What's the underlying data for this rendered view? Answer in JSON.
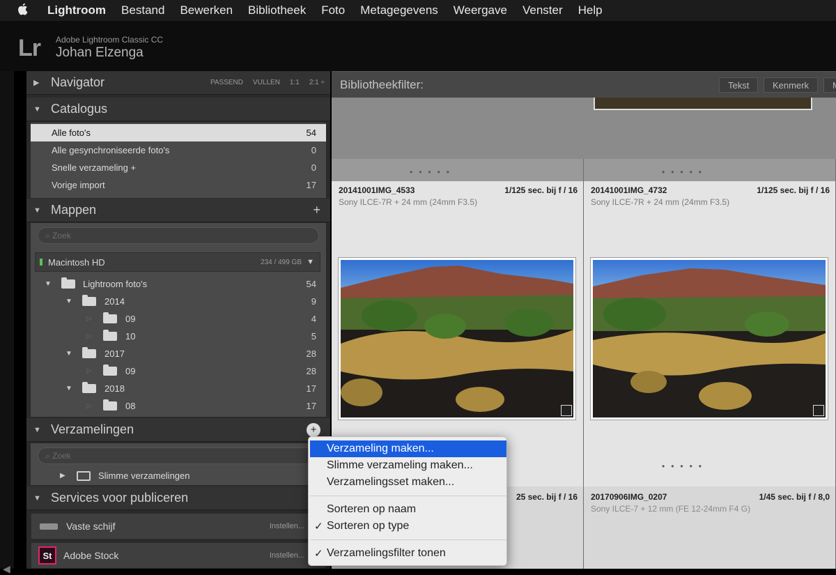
{
  "menubar": {
    "app": "Lightroom",
    "items": [
      "Bestand",
      "Bewerken",
      "Bibliotheek",
      "Foto",
      "Metagegevens",
      "Weergave",
      "Venster",
      "Help"
    ]
  },
  "identity": {
    "logo": "Lr",
    "product": "Adobe Lightroom Classic CC",
    "user": "Johan Elzenga"
  },
  "navigator": {
    "title": "Navigator",
    "options": [
      "PASSEND",
      "VULLEN",
      "1:1",
      "2:1 ÷"
    ]
  },
  "catalog": {
    "title": "Catalogus",
    "items": [
      {
        "label": "Alle foto's",
        "count": "54"
      },
      {
        "label": "Alle gesynchroniseerde foto's",
        "count": "0"
      },
      {
        "label": "Snelle verzameling +",
        "count": "0"
      },
      {
        "label": "Vorige import",
        "count": "17"
      }
    ]
  },
  "folders": {
    "title": "Mappen",
    "search_placeholder": "Zoek",
    "volume": {
      "name": "Macintosh HD",
      "size": "234 / 499 GB"
    },
    "items": [
      {
        "label": "Lightroom foto's",
        "count": "54"
      },
      {
        "label": "2014",
        "count": "9"
      },
      {
        "label": "09",
        "count": "4"
      },
      {
        "label": "10",
        "count": "5"
      },
      {
        "label": "2017",
        "count": "28"
      },
      {
        "label": "09",
        "count": "28"
      },
      {
        "label": "2018",
        "count": "17"
      },
      {
        "label": "08",
        "count": "17"
      }
    ]
  },
  "collections": {
    "title": "Verzamelingen",
    "search_placeholder": "Zoek",
    "items": [
      {
        "label": "Slimme verzamelingen"
      }
    ]
  },
  "publish": {
    "title": "Services voor publiceren",
    "items": [
      {
        "label": "Vaste schijf",
        "action": "Instellen..."
      },
      {
        "label": "Adobe Stock",
        "action": "Instellen..."
      }
    ]
  },
  "filterbar": {
    "title": "Bibliotheekfilter:",
    "buttons": [
      "Tekst",
      "Kenmerk",
      "M"
    ]
  },
  "grid": {
    "cells": [
      {
        "name": "20141001IMG_4533",
        "exposure": "1/125 sec. bij f / 16",
        "camera": "Sony ILCE-7R + 24 mm (24mm F3.5)"
      },
      {
        "name": "20141001IMG_4732",
        "exposure": "1/125 sec. bij f / 16",
        "camera": "Sony ILCE-7R + 24 mm (24mm F3.5)"
      },
      {
        "name": "",
        "exposure": "25 sec. bij f / 16",
        "camera": ""
      },
      {
        "name": "20170906IMG_0207",
        "exposure": "1/45 sec. bij f / 8,0",
        "camera": "Sony ILCE-7 + 12 mm (FE 12-24mm F4 G)"
      }
    ]
  },
  "popup": {
    "items": [
      {
        "label": "Verzameling maken...",
        "checked": false
      },
      {
        "label": "Slimme verzameling maken...",
        "checked": false
      },
      {
        "label": "Verzamelingsset maken...",
        "checked": false
      },
      {
        "label": "Sorteren op naam",
        "checked": false
      },
      {
        "label": "Sorteren op type",
        "checked": true
      },
      {
        "label": "Verzamelingsfilter tonen",
        "checked": true
      }
    ]
  },
  "colors": {
    "highlight": "#1a5ee0",
    "stock": "#e0256d",
    "volume_led": "#56c456"
  }
}
